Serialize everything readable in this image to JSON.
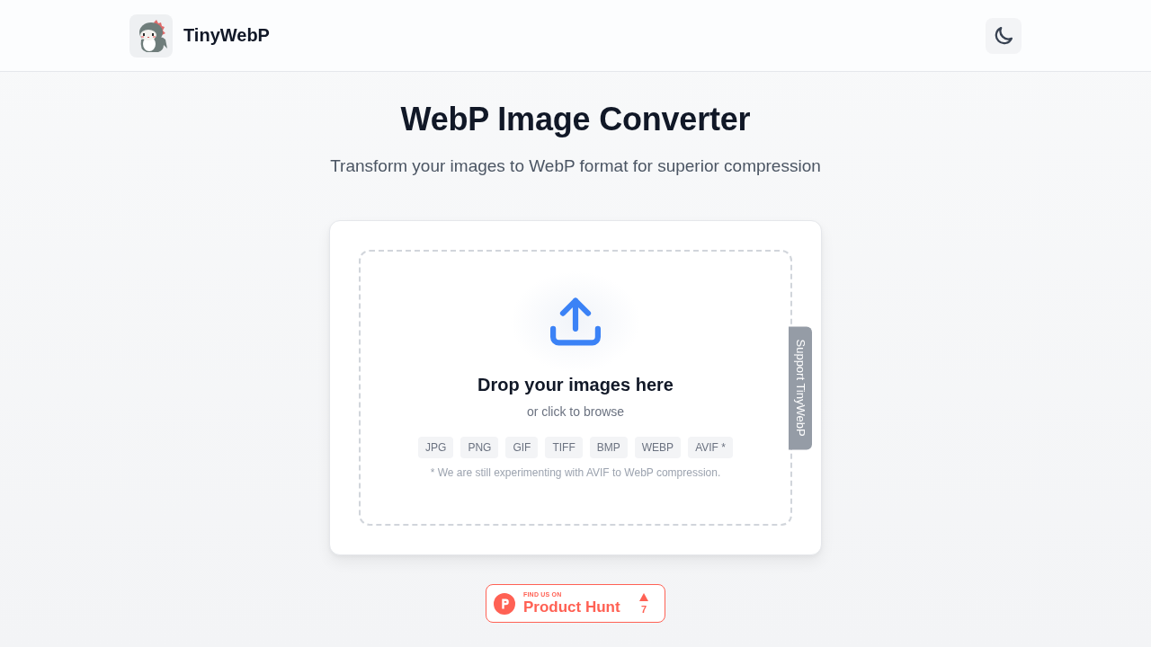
{
  "header": {
    "brand": "TinyWebP"
  },
  "hero": {
    "title": "WebP Image Converter",
    "subtitle": "Transform your images to WebP format for superior compression"
  },
  "dropzone": {
    "title": "Drop your images here",
    "hint": "or click to browse",
    "formats": [
      "JPG",
      "PNG",
      "GIF",
      "TIFF",
      "BMP",
      "WEBP",
      "AVIF *"
    ],
    "note": "* We are still experimenting with AVIF to WebP compression."
  },
  "support_tab": {
    "label": "Support TinyWebP"
  },
  "product_hunt": {
    "kicker": "FIND US ON",
    "name": "Product Hunt",
    "votes": "7"
  }
}
